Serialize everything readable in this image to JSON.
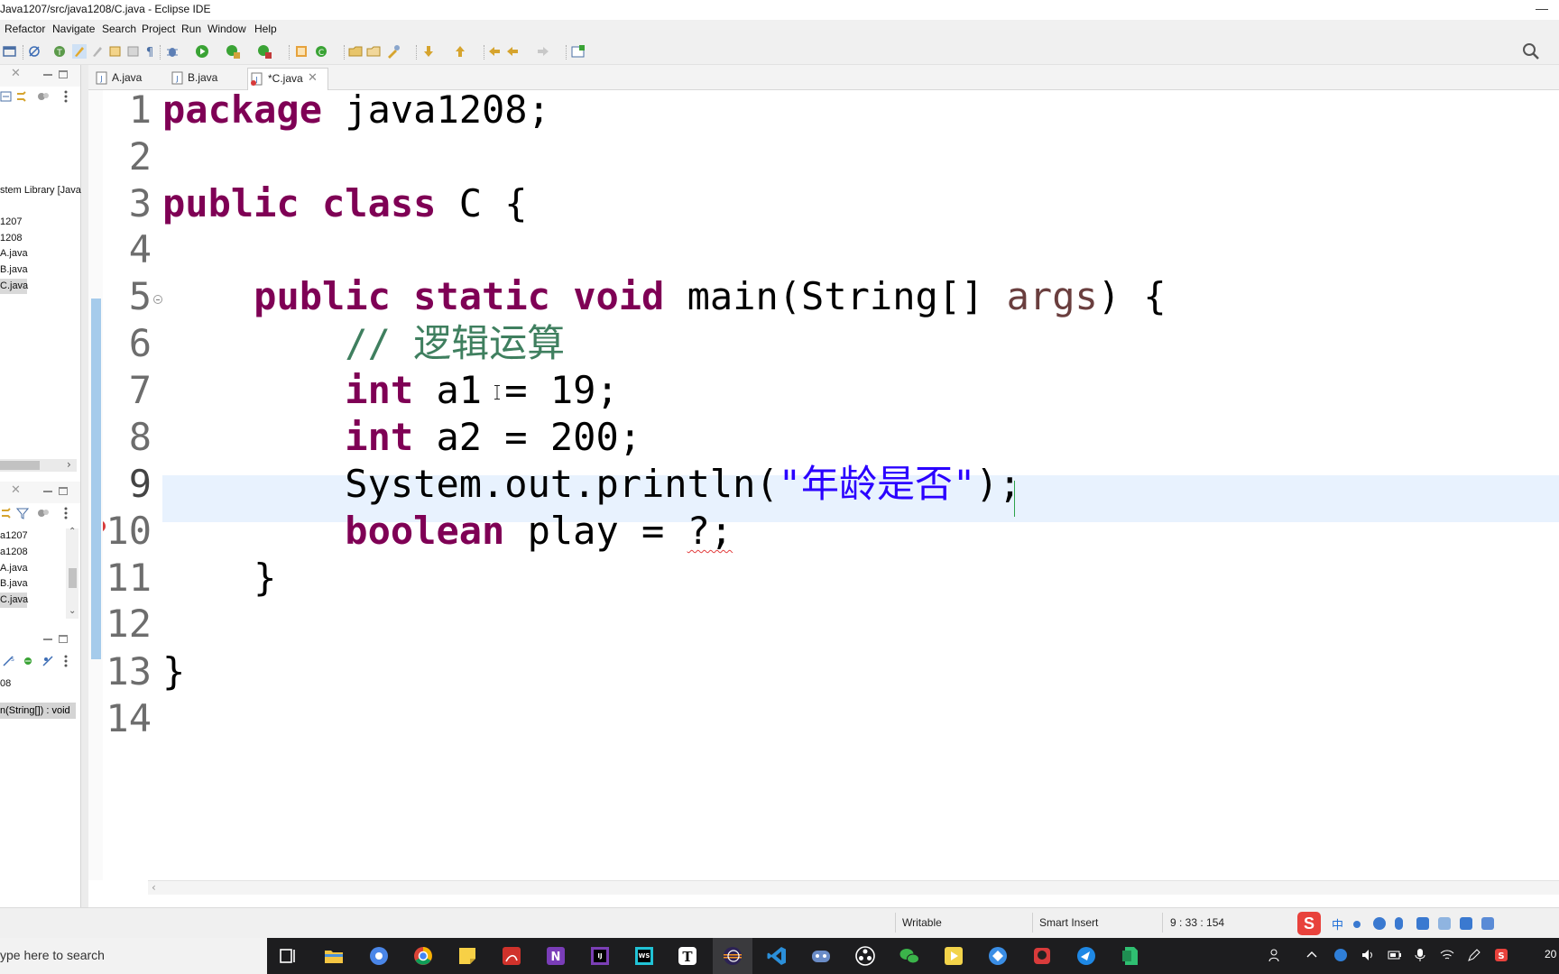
{
  "window": {
    "title": "Java1207/src/java1208/C.java - Eclipse IDE",
    "minimize_glyph": "—"
  },
  "menu": [
    "Refactor",
    "Navigate",
    "Search",
    "Project",
    "Run",
    "Window",
    "Help"
  ],
  "package_explorer": {
    "items": [
      "stem Library [Java",
      "1207",
      "1208",
      "A.java",
      "B.java",
      "C.java"
    ],
    "selected": "C.java"
  },
  "navigator": {
    "items": [
      "a1207",
      "a1208",
      "A.java",
      "B.java",
      "C.java"
    ],
    "selected": "C.java"
  },
  "outline": {
    "package": "08",
    "method": "n(String[]) : void"
  },
  "editor": {
    "tabs": [
      {
        "label": "A.java",
        "active": false
      },
      {
        "label": "B.java",
        "active": false
      },
      {
        "label": "*C.java",
        "active": true
      }
    ],
    "current_line": 9,
    "error_line": 10,
    "line_numbers": [
      "1",
      "2",
      "3",
      "4",
      "5",
      "6",
      "7",
      "8",
      "9",
      "10",
      "11",
      "12",
      "13",
      "14"
    ],
    "code": {
      "l1_kw": "package",
      "l1_rest": " java1208;",
      "l3_kw1": "public",
      "l3_kw2": "class",
      "l3_rest": " C {",
      "l5_indent": "    ",
      "l5_kw1": "public",
      "l5_kw2": "static",
      "l5_kw3": "void",
      "l5_mid": " main(String[] ",
      "l5_param": "args",
      "l5_end": ") {",
      "l6_indent": "        ",
      "l6_comment": "// 逻辑运算",
      "l7_indent": "        ",
      "l7_kw": "int",
      "l7_rest": " a1 = 19;",
      "l8_indent": "        ",
      "l8_kw": "int",
      "l8_rest": " a2 = 200;",
      "l9_indent": "        ",
      "l9_pre": "System.out.println(",
      "l9_str": "\"年龄是否\"",
      "l9_end": ");",
      "l10_indent": "        ",
      "l10_kw": "boolean",
      "l10_mid": " play = ",
      "l10_err": "?;",
      "l11_indent": "    ",
      "l11_rest": "}",
      "l13_rest": "}"
    }
  },
  "status": {
    "writable": "Writable",
    "insert_mode": "Smart Insert",
    "position": "9 : 33 : 154",
    "ime_label": "中"
  },
  "taskbar": {
    "search_placeholder": "ype here to search",
    "clock_fragment": "20"
  },
  "colors": {
    "keyword": "#7f0055",
    "comment": "#3f7f5f",
    "string": "#2a00ff",
    "current_line_bg": "#e8f2fe"
  }
}
